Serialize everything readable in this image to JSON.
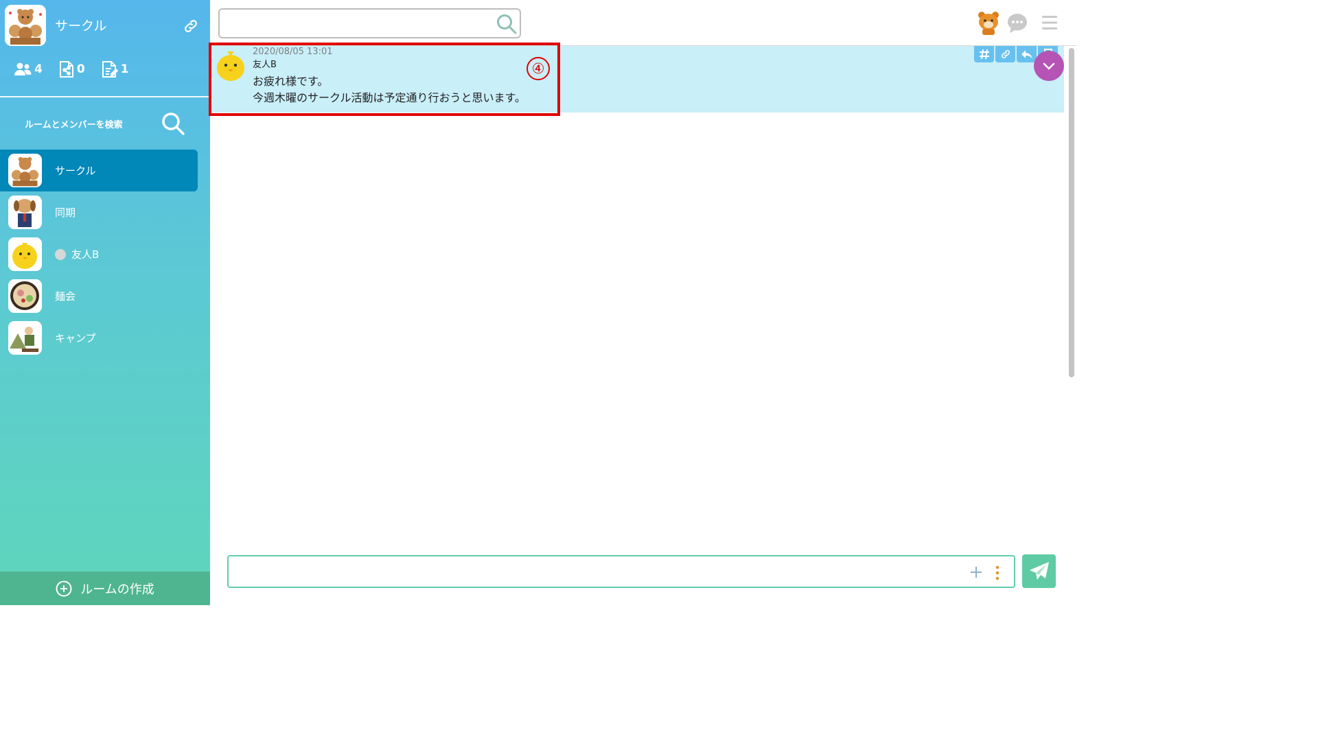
{
  "room": {
    "title": "サークル",
    "stats": {
      "members": "4",
      "files": "0",
      "notes": "1"
    }
  },
  "sidebar": {
    "search_label": "ルームとメンバーを検索",
    "rooms": [
      {
        "label": "サークル",
        "active": true
      },
      {
        "label": "同期"
      },
      {
        "label": "友人B",
        "status": "offline"
      },
      {
        "label": "麺会"
      },
      {
        "label": "キャンプ"
      }
    ],
    "create_label": "ルームの作成"
  },
  "topbar": {
    "search_value": "",
    "search_placeholder": ""
  },
  "messages": [
    {
      "time": "2020/08/05 13:01",
      "sender": "友人B",
      "lines": [
        "お疲れ様です。",
        "今週木曜のサークル活動は予定通り行おうと思います。"
      ]
    }
  ],
  "annotation": {
    "step": "④"
  },
  "composer": {
    "value": "",
    "placeholder": ""
  },
  "colors": {
    "active_room": "#0187b8",
    "message_bg": "#c9eff9",
    "create_bar": "#4fb590",
    "send_button": "#5fcba5",
    "scroll_button": "#b554b4",
    "highlight": "#e00000"
  }
}
